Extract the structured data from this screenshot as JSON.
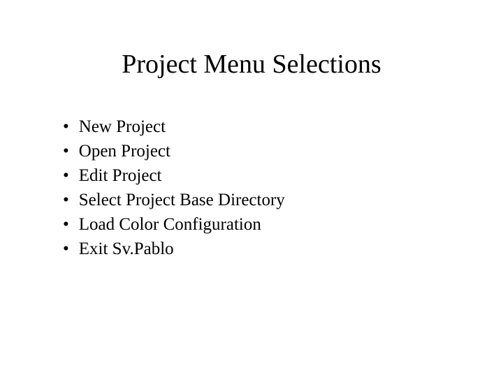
{
  "title": "Project Menu Selections",
  "bullets": [
    "New Project",
    "Open Project",
    "Edit Project",
    "Select Project Base Directory",
    "Load Color Configuration",
    "Exit Sv.Pablo"
  ]
}
